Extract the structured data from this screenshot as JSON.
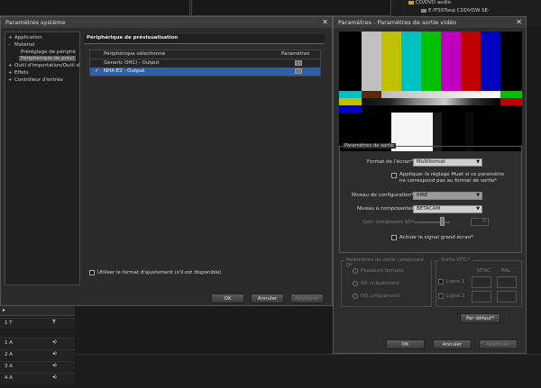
{
  "background": {
    "media_items": [
      "CD/DVD audio",
      "E:ITSSToop CDDVDW SE-"
    ],
    "tracks": [
      "1 T",
      "1 A",
      "2 A",
      "3 A",
      "4 A"
    ]
  },
  "system_dialog": {
    "title": "Paramètres système",
    "tree": [
      {
        "label": "Application",
        "expander": "+"
      },
      {
        "label": "Matériel",
        "expander": "-"
      },
      {
        "label": "Préréglage de périphé",
        "expander": ""
      },
      {
        "label": "Périphérique de prévi",
        "expander": ""
      },
      {
        "label": "Outil d'importation/Outil d",
        "expander": "+"
      },
      {
        "label": "Effets",
        "expander": "+"
      },
      {
        "label": "Contrôleur d'entrée",
        "expander": "+"
      }
    ],
    "panel_title": "Périphérique de prévisualisation",
    "list_header_device": "Périphérique sélectionné",
    "list_header_params": "Paramètres",
    "devices": [
      {
        "check": "",
        "label": "Generic OHCI - Output"
      },
      {
        "check": "✓",
        "label": "NHX-E2 - Output"
      }
    ],
    "fit_format_label": "Utiliser le format d'ajustement (s'il est disponible)",
    "ok_label": "OK",
    "cancel_label": "Annuler",
    "apply_label": "Appliquer"
  },
  "output_dialog": {
    "title": "Paramètres - Paramètres de sortie vidéo",
    "section_title": "Paramètres de sortie",
    "screen_format_label": "Format de l'écran*",
    "screen_format_value": "Multiformat",
    "mute_label_line1": "Appliquer le réglage Muet si ce paramètre",
    "mute_label_line2": "ne correspond pas au format de sortie*",
    "config_level_label": "Niveau de configuration*",
    "config_level_value": "0IRE",
    "component_level_label": "Niveau à composantes*",
    "component_level_value": "BETACAM",
    "gain_label": "Gain composant SD*",
    "gain_value": "0",
    "wide_signal_label": "Activer le signal grand écran*",
    "component_group_title": "Paramètres de sortie composant D*",
    "component_options": [
      "Plusieurs formats",
      "SD uniquement",
      "HD uniquement"
    ],
    "vitc_group_title": "Sortie VITC*",
    "vitc_col_ntsc": "NTSC",
    "vitc_col_pal": "PAL",
    "vitc_line1": "Ligne 1",
    "vitc_line2": "Ligne 2",
    "default_label": "Par défaut*",
    "ok_label": "OK",
    "cancel_label": "Annuler",
    "apply_label": "Appliquer"
  },
  "colors": {
    "bars_top": [
      "#c0c0c0",
      "#c0c000",
      "#00c0c0",
      "#00c000",
      "#c000c0",
      "#c00000",
      "#0000c0"
    ],
    "selection": "#2f5fa8",
    "panel_header": "#2a4f80"
  }
}
